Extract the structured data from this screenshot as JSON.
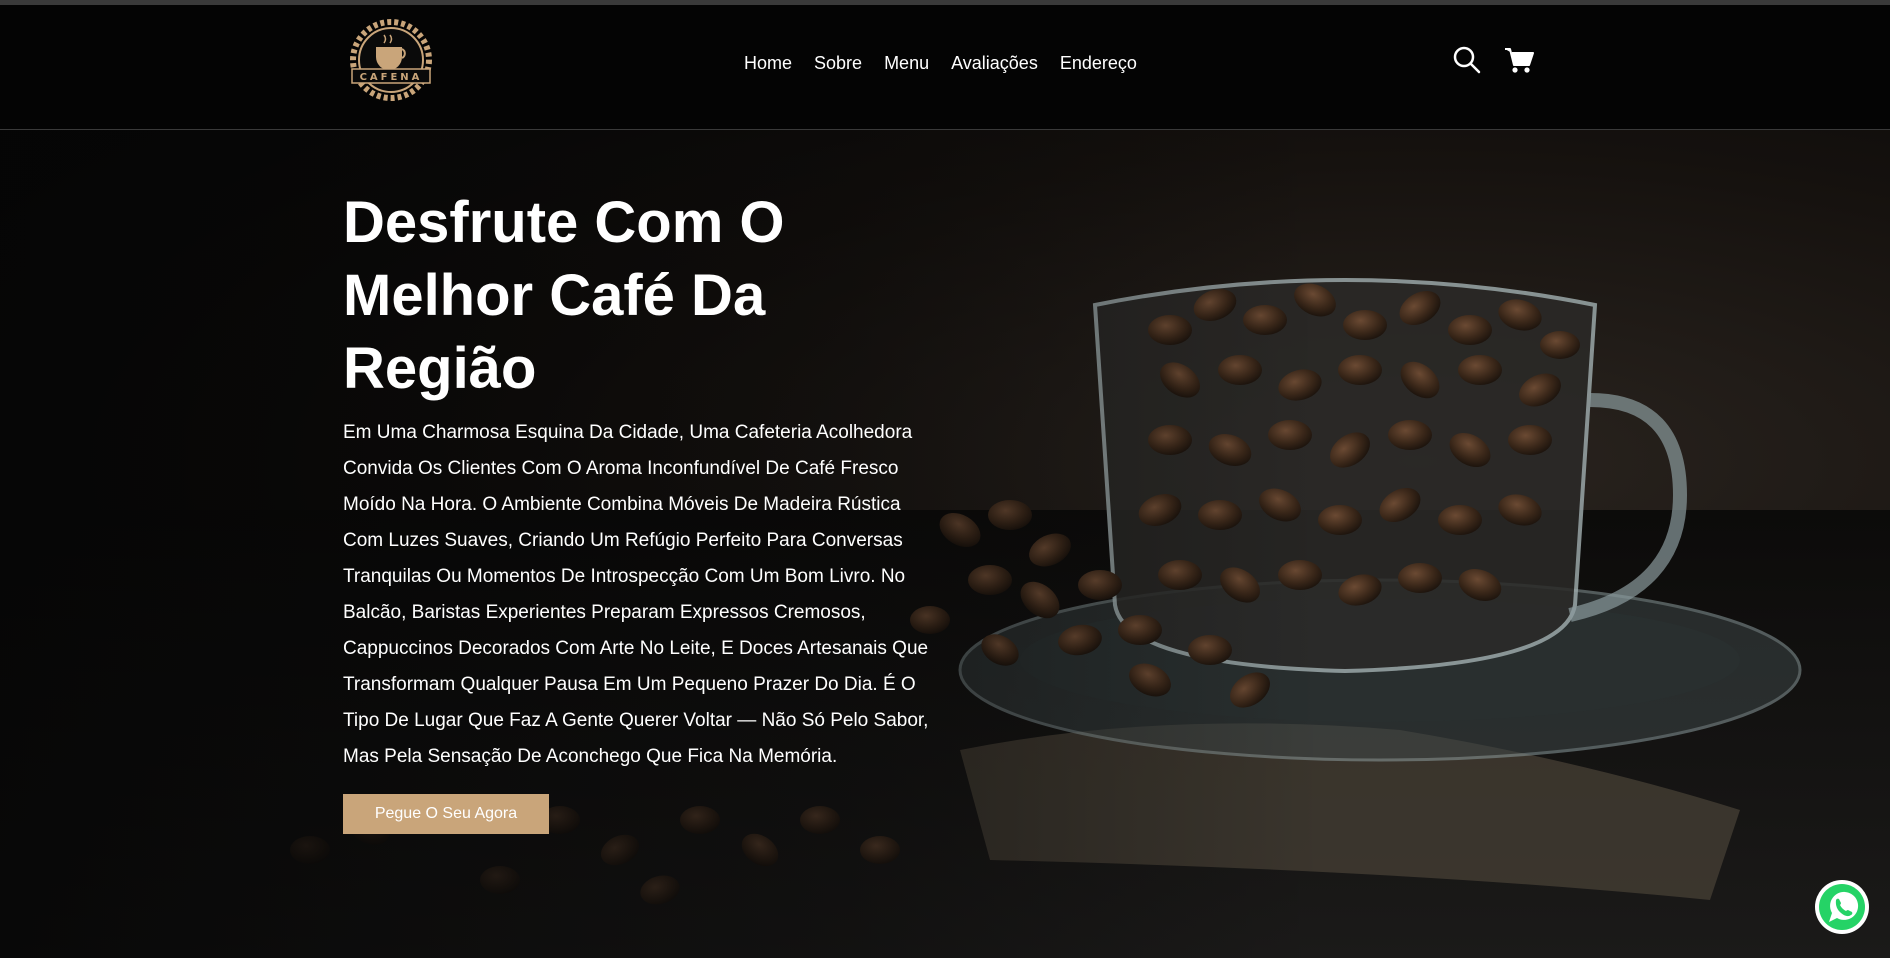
{
  "brand": {
    "logo_text": "CAFENA",
    "accent_color": "#c9a57a"
  },
  "nav": {
    "items": [
      {
        "label": "Home"
      },
      {
        "label": "Sobre"
      },
      {
        "label": "Menu"
      },
      {
        "label": "Avaliações"
      },
      {
        "label": "Endereço"
      }
    ]
  },
  "header_icons": {
    "search": "search-icon",
    "cart": "cart-icon"
  },
  "hero": {
    "title": "Desfrute Com O Melhor Café Da Região",
    "description": "Em Uma Charmosa Esquina Da Cidade, Uma Cafeteria Acolhedora Convida Os Clientes Com O Aroma Inconfundível De Café Fresco Moído Na Hora. O Ambiente Combina Móveis De Madeira Rústica Com Luzes Suaves, Criando Um Refúgio Perfeito Para Conversas Tranquilas Ou Momentos De Introspecção Com Um Bom Livro. No Balcão, Baristas Experientes Preparam Expressos Cremosos, Cappuccinos Decorados Com Arte No Leite, E Doces Artesanais Que Transformam Qualquer Pausa Em Um Pequeno Prazer Do Dia. É O Tipo De Lugar Que Faz A Gente Querer Voltar — Não Só Pelo Sabor, Mas Pela Sensação De Aconchego Que Fica Na Memória.",
    "cta_label": "Pegue O Seu Agora",
    "image": "coffee-beans-in-glass-cup"
  },
  "floating": {
    "whatsapp": "whatsapp-icon"
  }
}
